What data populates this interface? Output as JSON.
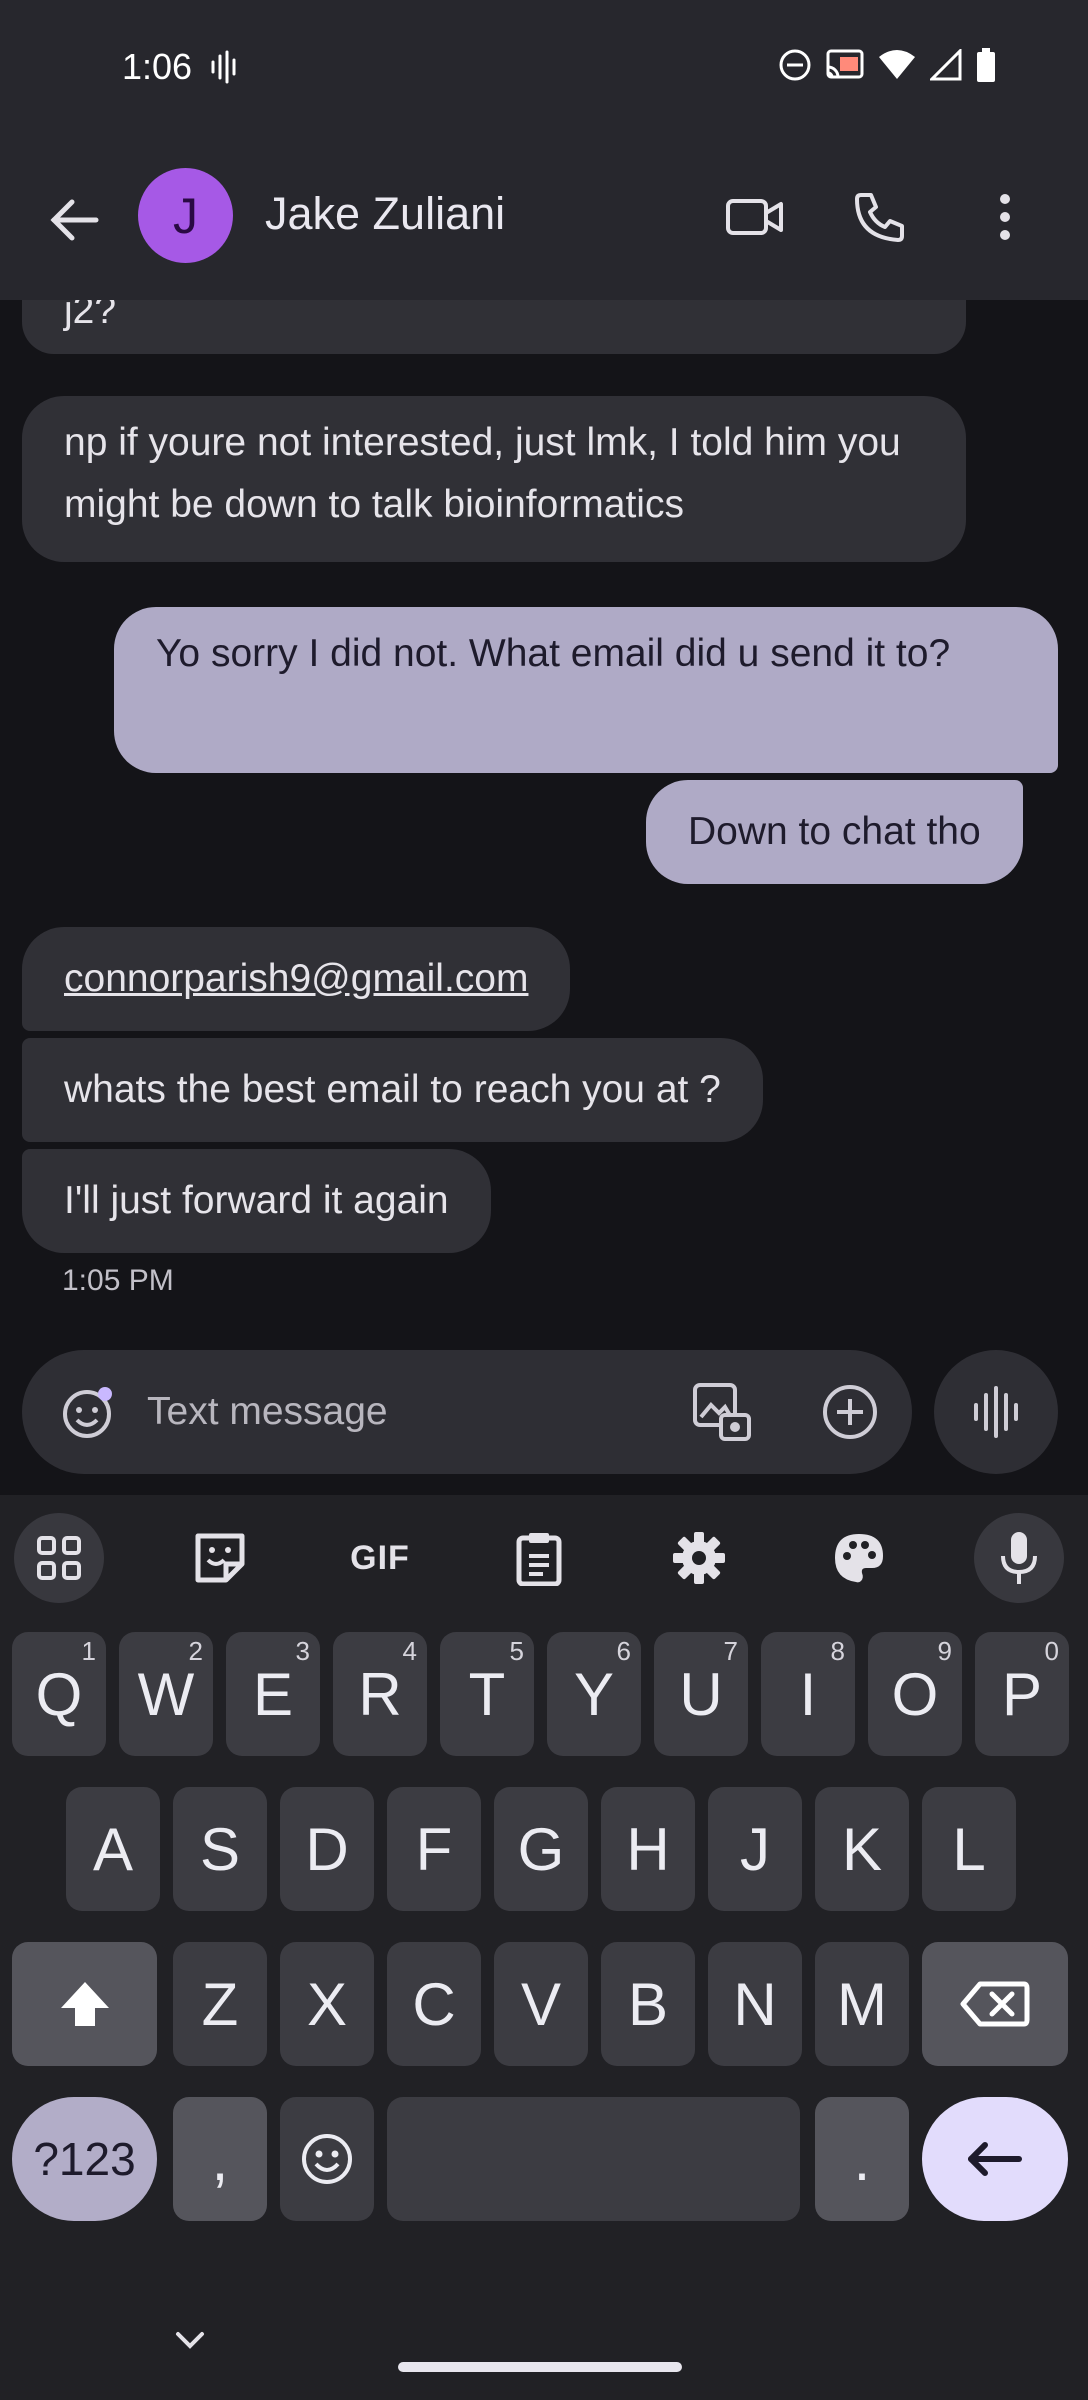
{
  "status_bar": {
    "time": "1:06"
  },
  "header": {
    "avatar_letter": "J",
    "contact_name": "Jake Zuliani"
  },
  "messages": [
    {
      "text": "j2?"
    },
    {
      "text": "np if youre not interested, just lmk, I told him you might be down to talk bioinformatics"
    },
    {
      "text": "Yo sorry I did not. What email did u send it to?"
    },
    {
      "text": "Down to chat tho"
    },
    {
      "text": "connorparish9@gmail.com"
    },
    {
      "text": "whats the best email to reach you at ?"
    },
    {
      "text": "I'll just forward it again"
    }
  ],
  "last_timestamp": "1:05 PM",
  "composer": {
    "placeholder": "Text message"
  },
  "keyboard": {
    "toolbar": {
      "gif": "GIF"
    },
    "row1": [
      {
        "k": "Q",
        "h": "1"
      },
      {
        "k": "W",
        "h": "2"
      },
      {
        "k": "E",
        "h": "3"
      },
      {
        "k": "R",
        "h": "4"
      },
      {
        "k": "T",
        "h": "5"
      },
      {
        "k": "Y",
        "h": "6"
      },
      {
        "k": "U",
        "h": "7"
      },
      {
        "k": "I",
        "h": "8"
      },
      {
        "k": "O",
        "h": "9"
      },
      {
        "k": "P",
        "h": "0"
      }
    ],
    "row2": [
      "A",
      "S",
      "D",
      "F",
      "G",
      "H",
      "J",
      "K",
      "L"
    ],
    "row3": [
      "Z",
      "X",
      "C",
      "V",
      "B",
      "N",
      "M"
    ],
    "symbols_label": "?123",
    "comma": ",",
    "period": "."
  },
  "icons": {
    "back": "arrow-back-icon",
    "video": "video-call-icon",
    "phone": "phone-icon",
    "more": "more-vert-icon",
    "emoji": "emoji-icon",
    "gallery": "gallery-icon",
    "add": "add-circle-icon",
    "voice": "voice-icon",
    "apps": "apps-grid-icon",
    "sticker": "sticker-icon",
    "clipboard": "clipboard-icon",
    "settings": "gear-icon",
    "theme": "palette-icon",
    "mic": "mic-icon",
    "shift": "shift-icon",
    "backspace": "backspace-icon",
    "enter": "enter-icon",
    "hide_keyboard": "chevron-down-icon"
  },
  "colors": {
    "incoming_bubble": "#303036",
    "outgoing_bubble": "#afaac6",
    "avatar": "#a659e6",
    "enter_key": "#e2dcfc"
  }
}
